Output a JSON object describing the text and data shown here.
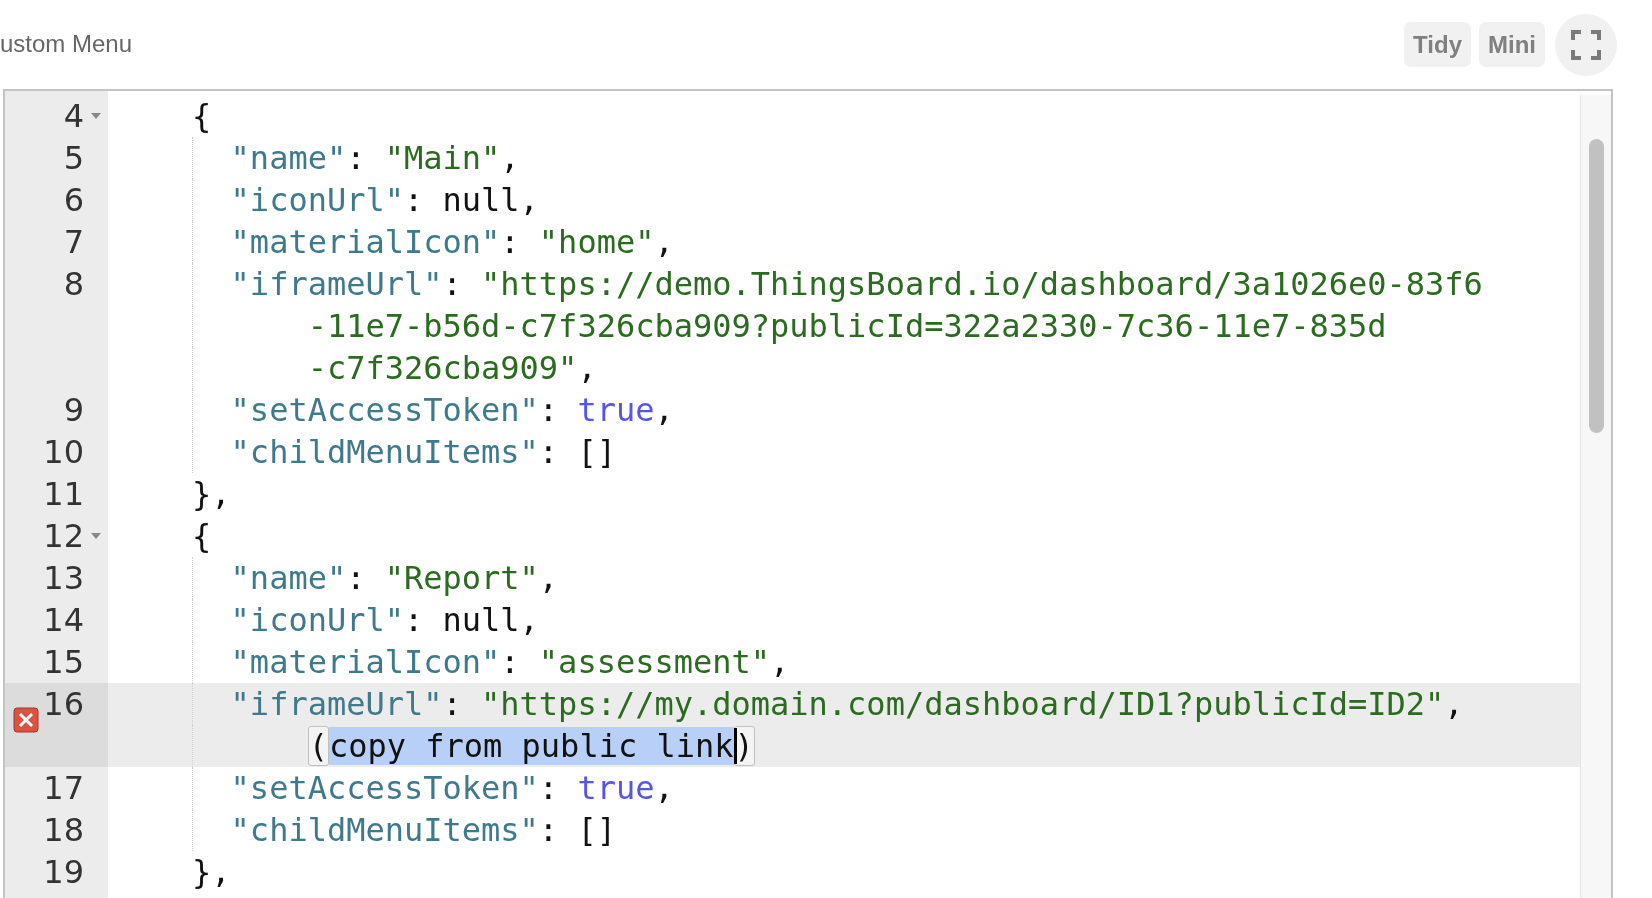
{
  "header": {
    "title": "ustom Menu",
    "buttons": [
      {
        "kind": "text",
        "label": "Tidy"
      },
      {
        "kind": "text",
        "label": "Mini"
      },
      {
        "kind": "fullscreen"
      }
    ]
  },
  "editor": {
    "rows": [
      {
        "kind": "brace",
        "number": "4",
        "fold": true,
        "active": false,
        "error": false,
        "tokens": [
          {
            "kind": "plain",
            "text": "{"
          }
        ]
      },
      {
        "kind": "member",
        "number": "5",
        "fold": false,
        "active": false,
        "error": false,
        "tokens": [
          {
            "kind": "key",
            "text": "\"name\""
          },
          {
            "kind": "plain",
            "text": ": "
          },
          {
            "kind": "string",
            "text": "\"Main\""
          },
          {
            "kind": "plain",
            "text": ","
          }
        ]
      },
      {
        "kind": "member",
        "number": "6",
        "fold": false,
        "active": false,
        "error": false,
        "tokens": [
          {
            "kind": "key",
            "text": "\"iconUrl\""
          },
          {
            "kind": "plain",
            "text": ": null,"
          }
        ]
      },
      {
        "kind": "member",
        "number": "7",
        "fold": false,
        "active": false,
        "error": false,
        "tokens": [
          {
            "kind": "key",
            "text": "\"materialIcon\""
          },
          {
            "kind": "plain",
            "text": ": "
          },
          {
            "kind": "string",
            "text": "\"home\""
          },
          {
            "kind": "plain",
            "text": ","
          }
        ]
      },
      {
        "kind": "member",
        "number": "8",
        "fold": false,
        "active": false,
        "error": false,
        "tokens": [
          {
            "kind": "key",
            "text": "\"iframeUrl\""
          },
          {
            "kind": "plain",
            "text": ": "
          },
          {
            "kind": "string",
            "text": "\"https://demo.ThingsBoard.io/dashboard/3a1026e0-83f6"
          }
        ]
      },
      {
        "kind": "wrap",
        "active": false,
        "error": false,
        "tokens": [
          {
            "kind": "string",
            "text": "-11e7-b56d-c7f326cba909?publicId=322a2330-7c36-11e7-835d"
          }
        ]
      },
      {
        "kind": "wrap",
        "active": false,
        "error": false,
        "tokens": [
          {
            "kind": "string",
            "text": "-c7f326cba909\""
          },
          {
            "kind": "plain",
            "text": ","
          }
        ]
      },
      {
        "kind": "member",
        "number": "9",
        "fold": false,
        "active": false,
        "error": false,
        "tokens": [
          {
            "kind": "key",
            "text": "\"setAccessToken\""
          },
          {
            "kind": "plain",
            "text": ": "
          },
          {
            "kind": "bool",
            "text": "true"
          },
          {
            "kind": "plain",
            "text": ","
          }
        ]
      },
      {
        "kind": "member",
        "number": "10",
        "fold": false,
        "active": false,
        "error": false,
        "tokens": [
          {
            "kind": "key",
            "text": "\"childMenuItems\""
          },
          {
            "kind": "plain",
            "text": ": []"
          }
        ]
      },
      {
        "kind": "brace",
        "number": "11",
        "fold": false,
        "active": false,
        "error": false,
        "tokens": [
          {
            "kind": "plain",
            "text": "},"
          }
        ]
      },
      {
        "kind": "brace",
        "number": "12",
        "fold": true,
        "active": false,
        "error": false,
        "tokens": [
          {
            "kind": "plain",
            "text": "{"
          }
        ]
      },
      {
        "kind": "member",
        "number": "13",
        "fold": false,
        "active": false,
        "error": false,
        "tokens": [
          {
            "kind": "key",
            "text": "\"name\""
          },
          {
            "kind": "plain",
            "text": ": "
          },
          {
            "kind": "string",
            "text": "\"Report\""
          },
          {
            "kind": "plain",
            "text": ","
          }
        ]
      },
      {
        "kind": "member",
        "number": "14",
        "fold": false,
        "active": false,
        "error": false,
        "tokens": [
          {
            "kind": "key",
            "text": "\"iconUrl\""
          },
          {
            "kind": "plain",
            "text": ": null,"
          }
        ]
      },
      {
        "kind": "member",
        "number": "15",
        "fold": false,
        "active": false,
        "error": false,
        "tokens": [
          {
            "kind": "key",
            "text": "\"materialIcon\""
          },
          {
            "kind": "plain",
            "text": ": "
          },
          {
            "kind": "string",
            "text": "\"assessment\""
          },
          {
            "kind": "plain",
            "text": ","
          }
        ]
      },
      {
        "kind": "member",
        "number": "16",
        "fold": false,
        "active": true,
        "error": true,
        "tokens": [
          {
            "kind": "key",
            "text": "\"iframeUrl\""
          },
          {
            "kind": "plain",
            "text": ": "
          },
          {
            "kind": "string",
            "text": "\"https://my.domain.com/dashboard/ID1?publicId=ID2\""
          },
          {
            "kind": "plain",
            "text": ","
          }
        ]
      },
      {
        "kind": "wrap",
        "active": true,
        "error": false,
        "tokens": [
          {
            "kind": "match",
            "text": "("
          },
          {
            "kind": "selected",
            "text": "copy from public link"
          },
          {
            "kind": "cursor"
          },
          {
            "kind": "match",
            "text": ")"
          }
        ]
      },
      {
        "kind": "member",
        "number": "17",
        "fold": false,
        "active": false,
        "error": false,
        "tokens": [
          {
            "kind": "key",
            "text": "\"setAccessToken\""
          },
          {
            "kind": "plain",
            "text": ": "
          },
          {
            "kind": "bool",
            "text": "true"
          },
          {
            "kind": "plain",
            "text": ","
          }
        ]
      },
      {
        "kind": "member",
        "number": "18",
        "fold": false,
        "active": false,
        "error": false,
        "tokens": [
          {
            "kind": "key",
            "text": "\"childMenuItems\""
          },
          {
            "kind": "plain",
            "text": ": []"
          }
        ]
      },
      {
        "kind": "brace",
        "number": "19",
        "fold": false,
        "active": false,
        "error": false,
        "tokens": [
          {
            "kind": "plain",
            "text": "},"
          }
        ]
      }
    ]
  }
}
